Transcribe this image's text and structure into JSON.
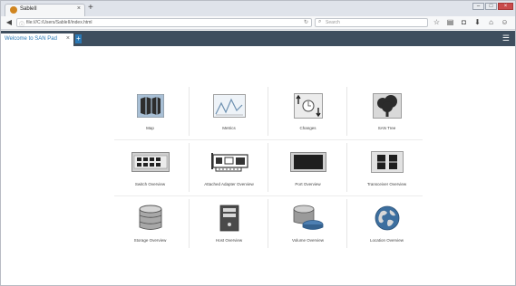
{
  "browser": {
    "tab_title": "SableII",
    "tab_close": "×",
    "new_tab": "+",
    "url": "file:///C:/Users/SableII/index.html",
    "search_placeholder": "Search",
    "window_controls": [
      "–",
      "□",
      "×"
    ],
    "toolbar_icons": [
      "star-icon",
      "reading-list-icon",
      "pocket-icon",
      "download-icon",
      "home-icon",
      "smile-icon",
      "menu-icon"
    ]
  },
  "app": {
    "tab_label": "Welcome to SAN Pad",
    "tab_close": "×",
    "add_tab": "+",
    "menu_icon": "hamburger-menu-icon",
    "header_color": "#3e4e5e",
    "accent": "#2a78b5"
  },
  "tiles": [
    {
      "label": "Map",
      "icon": "map-icon"
    },
    {
      "label": "Metrics",
      "icon": "metrics-chart-icon"
    },
    {
      "label": "Changes",
      "icon": "changes-icon"
    },
    {
      "label": "SAN Tree",
      "icon": "tree-icon"
    },
    {
      "label": "Switch Overview",
      "icon": "switch-icon"
    },
    {
      "label": "Attached Adapter Overview",
      "icon": "adapter-card-icon"
    },
    {
      "label": "Port Overview",
      "icon": "port-icon"
    },
    {
      "label": "Transceiver Overview",
      "icon": "transceiver-icon"
    },
    {
      "label": "Storage Overview",
      "icon": "storage-database-icon"
    },
    {
      "label": "Host Overview",
      "icon": "host-server-icon"
    },
    {
      "label": "Volume Overview",
      "icon": "volume-icon"
    },
    {
      "label": "Location Overview",
      "icon": "globe-icon"
    }
  ]
}
